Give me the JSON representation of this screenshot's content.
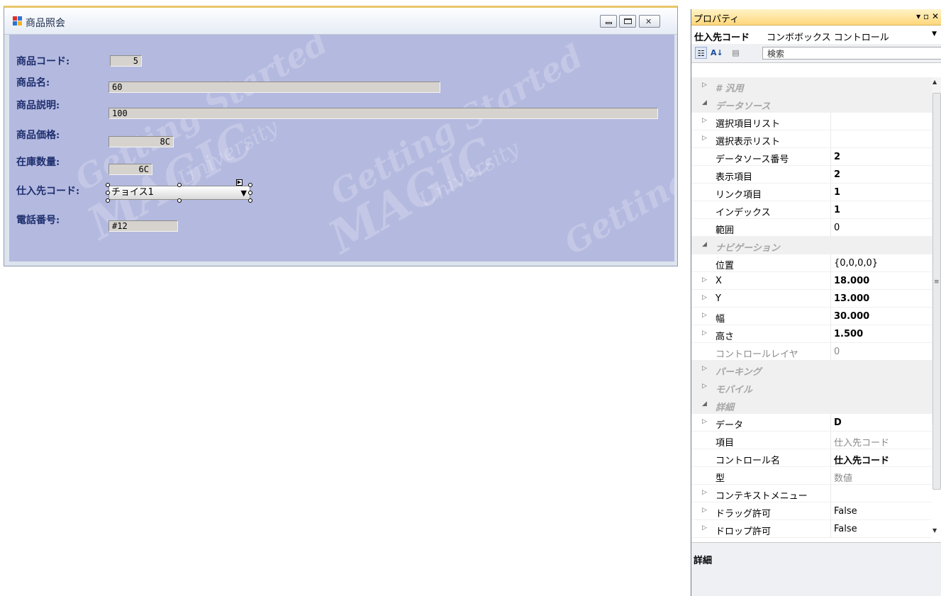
{
  "form": {
    "title": "商品照会",
    "fields": [
      {
        "label": "商品コード:",
        "value": "5"
      },
      {
        "label": "商品名:",
        "value": "60"
      },
      {
        "label": "商品説明:",
        "value": "100"
      },
      {
        "label": "商品価格:",
        "value": "8C"
      },
      {
        "label": "在庫数量:",
        "value": "6C"
      },
      {
        "label": "仕入先コード:",
        "value": "チョイス1"
      },
      {
        "label": "電話番号:",
        "value": "#12"
      }
    ],
    "watermark": {
      "text1": "Getting Started",
      "text2": "MAGIC",
      "text3": "University"
    }
  },
  "properties": {
    "title": "プロパティ",
    "title_controls": "▾ ▫ ✕",
    "object_name": "仕入先コード",
    "object_type": "コンボボックス コントロール",
    "search_placeholder": "検索",
    "rows": [
      {
        "name": "# 汎用",
        "value": "",
        "category": true
      },
      {
        "name": "データソース",
        "value": "",
        "category": true
      },
      {
        "name": "選択項目リスト",
        "value": ""
      },
      {
        "name": "選択表示リスト",
        "value": ""
      },
      {
        "name": "データソース番号",
        "value": "2"
      },
      {
        "name": "表示項目",
        "value": "2"
      },
      {
        "name": "リンク項目",
        "value": "1"
      },
      {
        "name": "インデックス",
        "value": "1"
      },
      {
        "name": "範囲",
        "value": "0"
      },
      {
        "name": "ナビゲーション",
        "value": "",
        "category": true
      },
      {
        "name": "位置",
        "value": "{0,0,0,0}"
      },
      {
        "name": "X",
        "value": "18.000"
      },
      {
        "name": "Y",
        "value": "13.000"
      },
      {
        "name": "幅",
        "value": "30.000"
      },
      {
        "name": "高さ",
        "value": "1.500"
      },
      {
        "name": "コントロールレイヤ",
        "value": "0"
      },
      {
        "name": "パーキング",
        "value": "",
        "category": true
      },
      {
        "name": "モバイル",
        "value": "",
        "category": true
      },
      {
        "name": "詳細",
        "value": "",
        "category": true
      },
      {
        "name": "データ",
        "value": "D"
      },
      {
        "name": "項目",
        "value": "仕入先コード"
      },
      {
        "name": "コントロール名",
        "value": "仕入先コード"
      },
      {
        "name": "型",
        "value": "数値"
      },
      {
        "name": "コンテキストメニュー",
        "value": ""
      },
      {
        "name": "ドラッグ許可",
        "value": "False"
      },
      {
        "name": "ドロップ許可",
        "value": "False"
      }
    ],
    "description_title": "詳細"
  }
}
